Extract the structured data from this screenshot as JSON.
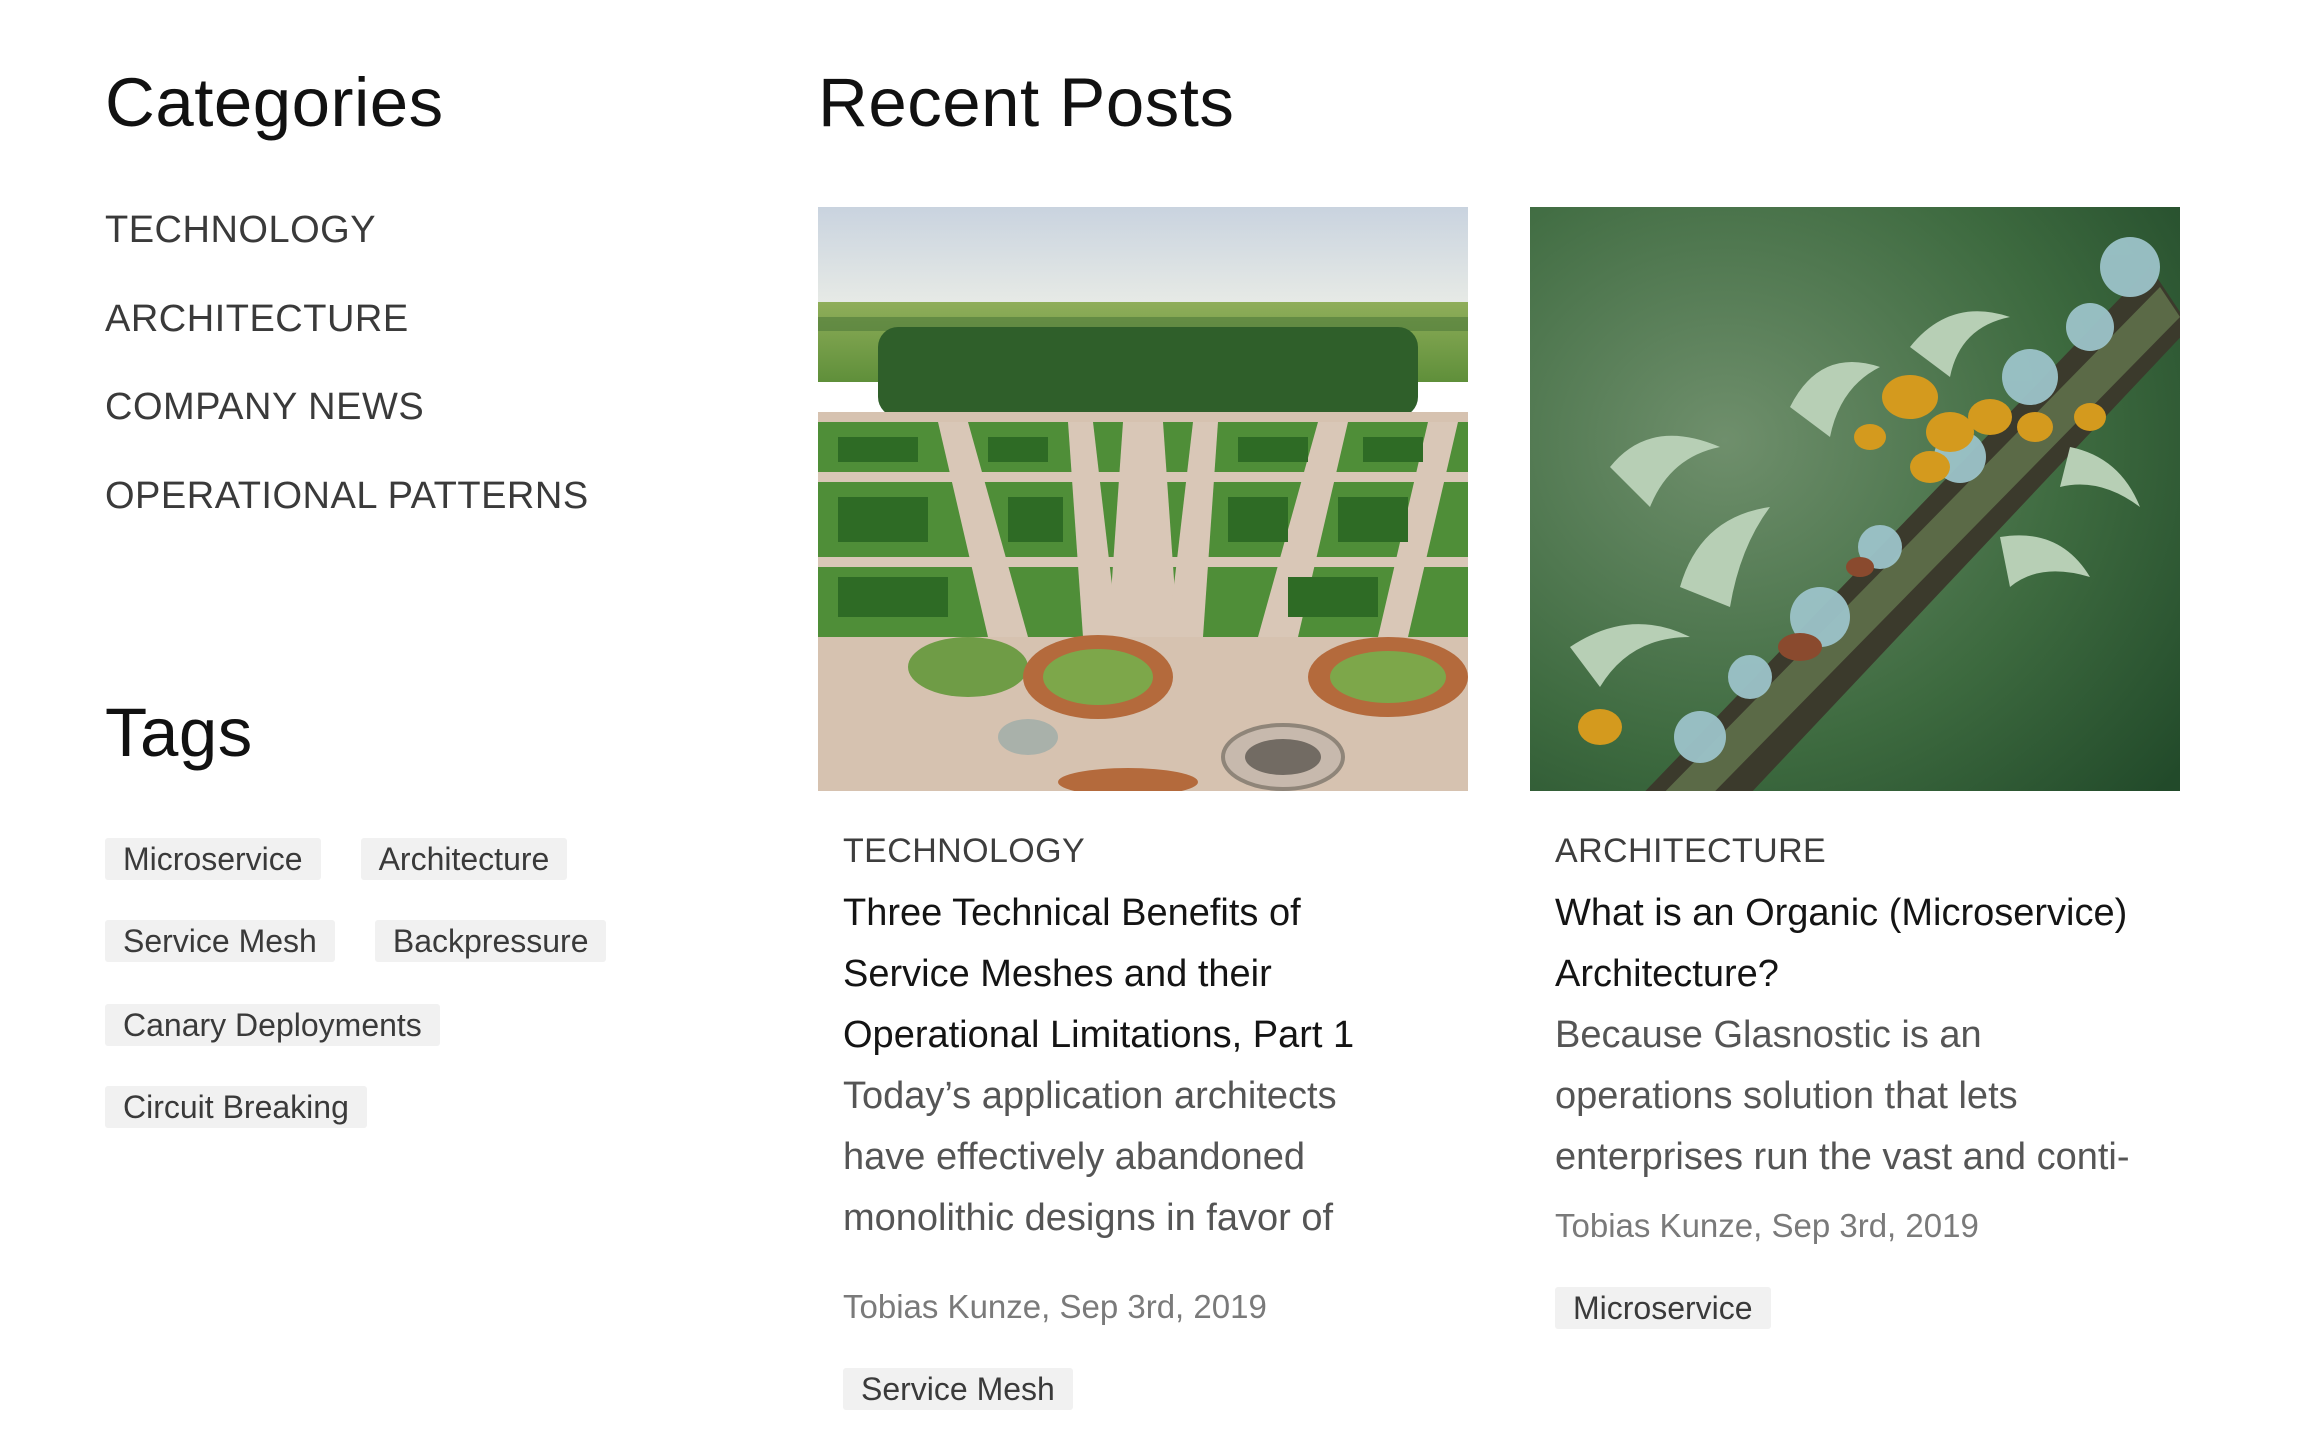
{
  "categories": {
    "title": "Categories",
    "items": [
      "TECHNOLOGY",
      "ARCHITECTURE",
      "COMPANY NEWS",
      "OPERATIONAL PATTERNS"
    ]
  },
  "tags": {
    "title": "Tags",
    "rows": [
      [
        "Microservice",
        "Architecture"
      ],
      [
        "Service Mesh",
        "Backpressure"
      ],
      [
        "Canary Deployments"
      ],
      [
        "Circuit Breaking"
      ]
    ]
  },
  "recent_posts": {
    "title": "Recent Posts",
    "posts": [
      {
        "image": "aerial-formal-garden-photo",
        "category": "TECHNOLOGY",
        "title_lines": [
          "Three Technical Benefits of",
          "Service Meshes and their",
          "Operational Limitations, Part 1"
        ],
        "excerpt_lines": [
          "Today’s application architects",
          "have effectively abandoned",
          "monolithic designs in favor of"
        ],
        "meta": "Tobias Kunze, Sep 3rd, 2019",
        "tag": "Service Mesh"
      },
      {
        "image": "lichen-on-branch-photo",
        "category": "ARCHITECTURE",
        "title_lines": [
          "What is an Organic (Microservice)",
          "Architecture?"
        ],
        "excerpt_lines": [
          "Because Glasnostic is an",
          "operations solution that lets",
          "enterprises run the vast and conti-"
        ],
        "meta": "Tobias Kunze, Sep 3rd, 2019",
        "tag": "Microservice"
      }
    ]
  },
  "colors": {
    "background": "#ffffff",
    "heading": "#111111",
    "body_text": "#555555",
    "meta_text": "#7a7a7a",
    "tag_bg": "#f1f1f1"
  }
}
